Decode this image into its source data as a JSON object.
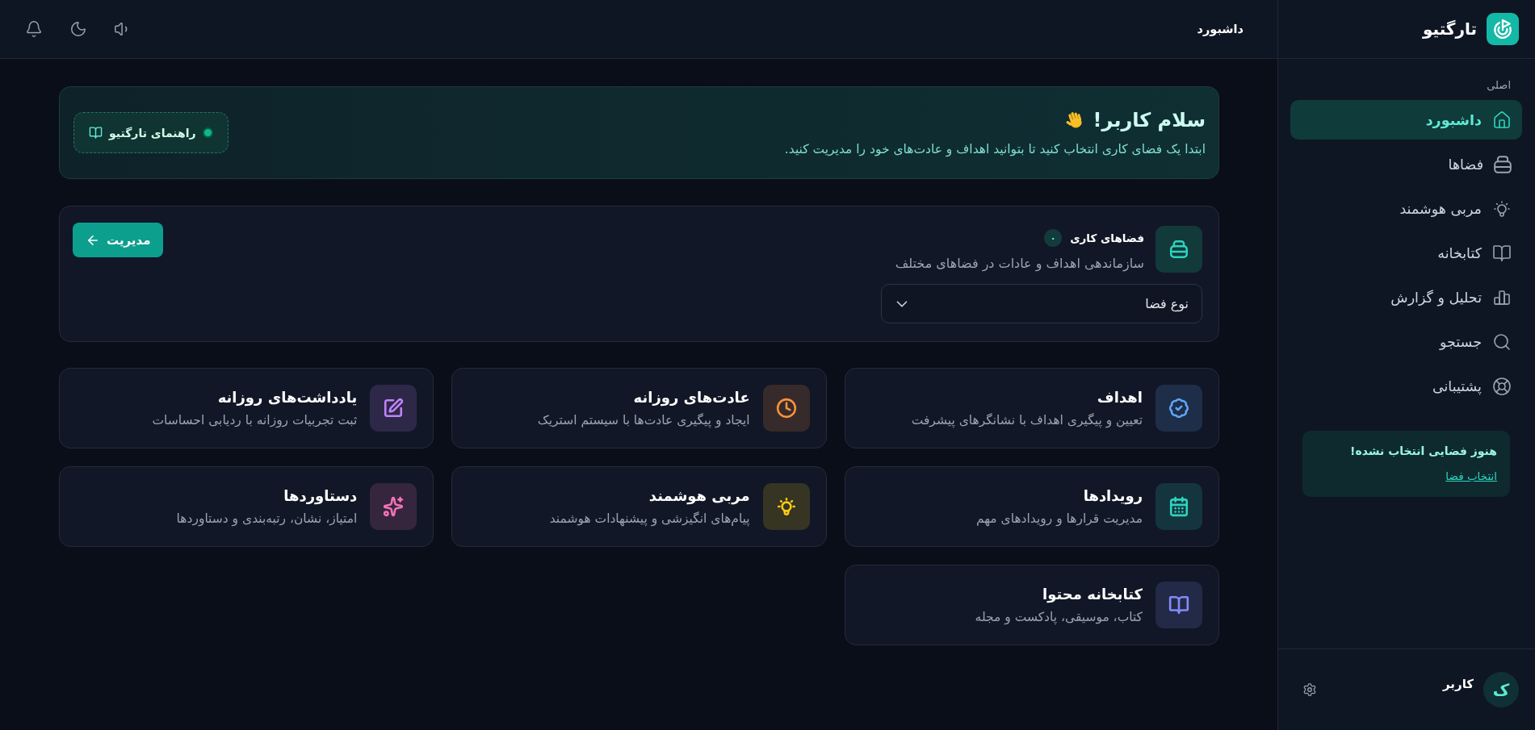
{
  "header": {
    "title": "داشبورد"
  },
  "welcome": {
    "title": "سلام کاربر!",
    "text": "ابتدا یک فضای کاری انتخاب کنید تا بتوانید اهداف و عادت‌های خود را مدیریت کنید.",
    "guide_button": "راهنمای تارگتیو"
  },
  "workspaces": {
    "title": "فضاهای کاری",
    "count": "۰",
    "subtitle": "سازماندهی اهداف و عادات در فضاهای مختلف",
    "manage_button": "مدیریت",
    "select": {
      "value": "نوع فضا"
    }
  },
  "features": [
    {
      "title": "اهداف",
      "description": "تعیین و پیگیری اهداف با نشانگرهای پیشرفت",
      "color": "#60a5fa"
    },
    {
      "title": "عادت‌های روزانه",
      "description": "ایجاد و پیگیری عادت‌ها با سیستم استریک",
      "color": "#fb923c"
    },
    {
      "title": "یادداشت‌های روزانه",
      "description": "ثبت تجربیات روزانه با ردیابی احساسات",
      "color": "#c084fc"
    },
    {
      "title": "رویدادها",
      "description": "مدیریت قرارها و رویدادهای مهم",
      "color": "#2dd4bf"
    },
    {
      "title": "مربی هوشمند",
      "description": "پیام‌های انگیزشی و پیشنهادات هوشمند",
      "color": "#facc15"
    },
    {
      "title": "دستاوردها",
      "description": "امتیاز، نشان، رتبه‌بندی و دستاوردها",
      "color": "#f472b6"
    },
    {
      "title": "کتابخانه محتوا",
      "description": "کتاب، موسیقی، پادکست و مجله",
      "color": "#818cf8"
    }
  ],
  "sidebar": {
    "logo": "تارگتیو",
    "section_label": "اصلی",
    "items": [
      {
        "label": "داشبورد",
        "selected": true
      },
      {
        "label": "فضاها",
        "selected": false
      },
      {
        "label": "مربی هوشمند",
        "selected": false
      },
      {
        "label": "کتابخانه",
        "selected": false
      },
      {
        "label": "تحلیل و گزارش",
        "selected": false
      },
      {
        "label": "جستجو",
        "selected": false
      },
      {
        "label": "پشتیبانی",
        "selected": false
      }
    ],
    "notice": {
      "title": "هنوز فضایی انتخاب نشده!",
      "link": "انتخاب فضا"
    },
    "user": {
      "avatar": "ک",
      "name": "کاربر"
    }
  }
}
